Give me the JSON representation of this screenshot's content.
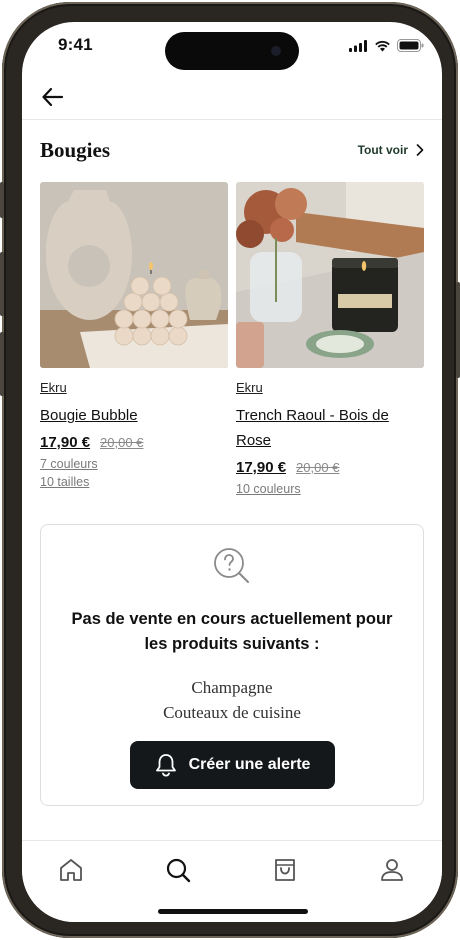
{
  "status_bar": {
    "time": "9:41"
  },
  "section": {
    "title": "Bougies",
    "see_all_label": "Tout voir"
  },
  "products": [
    {
      "brand": "Ekru",
      "name": "Bougie Bubble",
      "price": "17,90 €",
      "old_price": "20,00 €",
      "colors": "7 couleurs",
      "sizes": "10 tailles"
    },
    {
      "brand": "Ekru",
      "name": "Trench Raoul - Bois de Rose",
      "price": "17,90 €",
      "old_price": "20,00 €",
      "colors": "10 couleurs"
    }
  ],
  "alert_card": {
    "message": "Pas de vente en cours actuellement pour les produits suivants :",
    "items": [
      "Champagne",
      "Couteaux de cuisine"
    ],
    "button_label": "Créer une alerte"
  },
  "tabbar": {
    "items": [
      "home-icon",
      "search-icon",
      "bag-icon",
      "user-icon"
    ]
  }
}
